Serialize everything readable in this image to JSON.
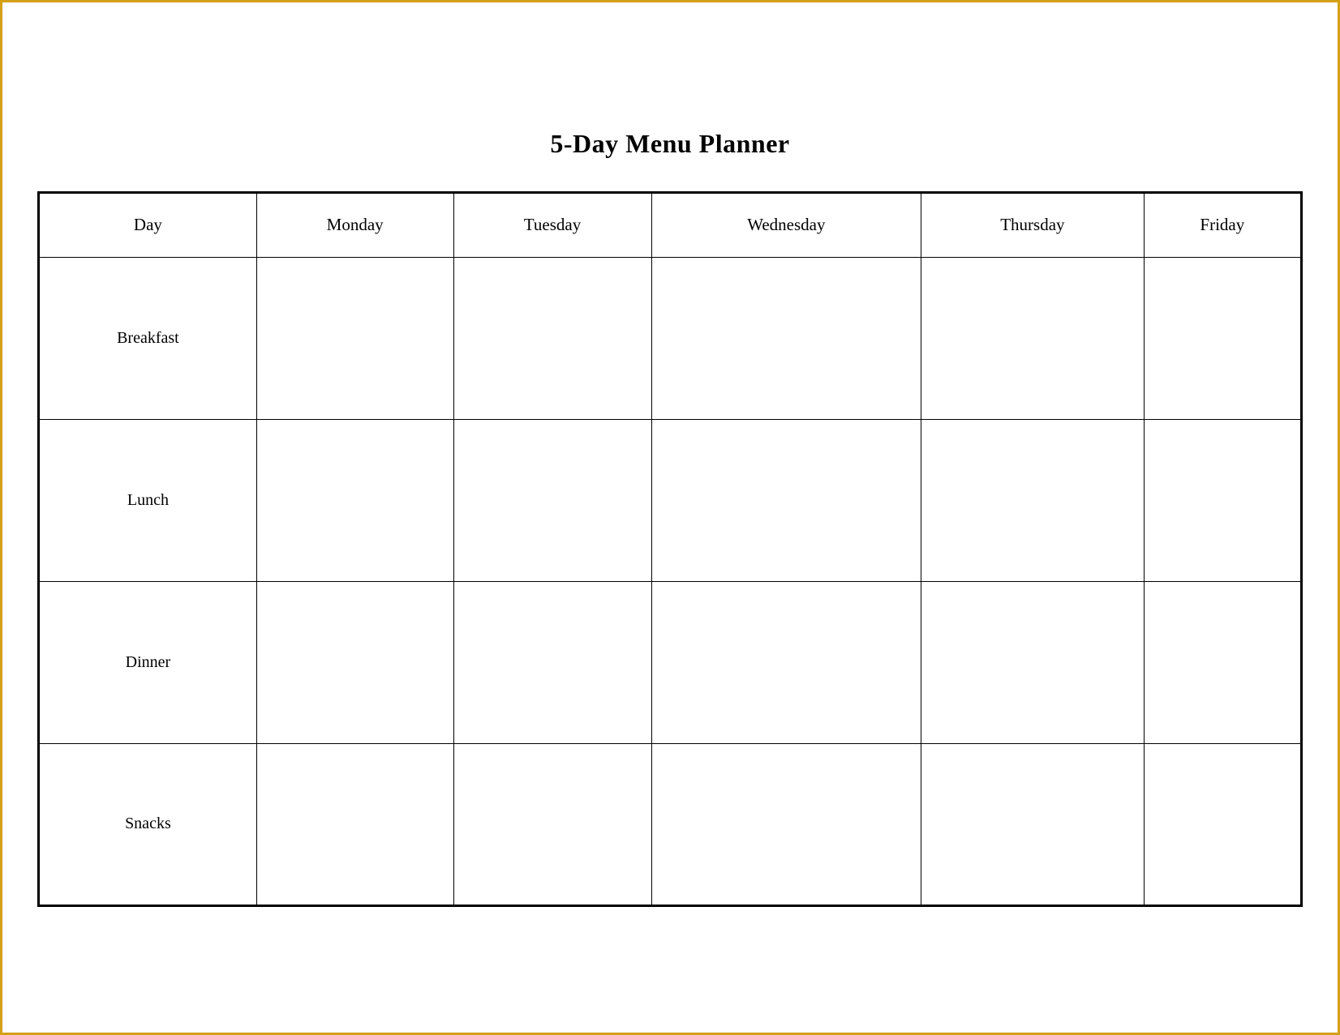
{
  "title": "5-Day Menu Planner",
  "table": {
    "headers": [
      "Day",
      "Monday",
      "Tuesday",
      "Wednesday",
      "Thursday",
      "Friday"
    ],
    "rows": [
      {
        "label": "Breakfast",
        "cells": [
          "",
          "",
          "",
          "",
          ""
        ]
      },
      {
        "label": "Lunch",
        "cells": [
          "",
          "",
          "",
          "",
          ""
        ]
      },
      {
        "label": "Dinner",
        "cells": [
          "",
          "",
          "",
          "",
          ""
        ]
      },
      {
        "label": "Snacks",
        "cells": [
          "",
          "",
          "",
          "",
          ""
        ]
      }
    ]
  }
}
